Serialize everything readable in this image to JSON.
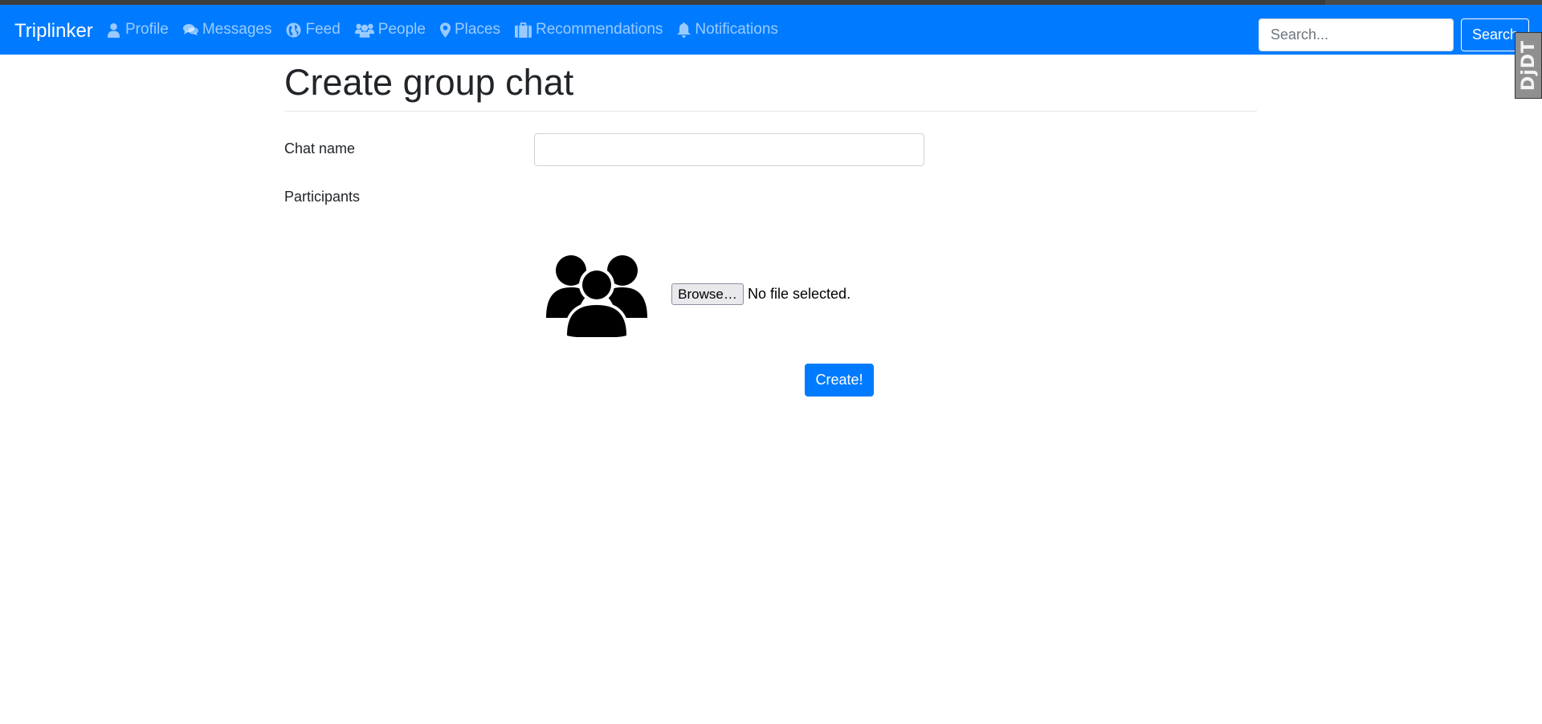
{
  "navbar": {
    "brand": "Triplinker",
    "items": [
      {
        "label": "Profile",
        "icon": "user-icon"
      },
      {
        "label": "Messages",
        "icon": "comments-icon"
      },
      {
        "label": "Feed",
        "icon": "globe-icon"
      },
      {
        "label": "People",
        "icon": "users-icon"
      },
      {
        "label": "Places",
        "icon": "map-marker-icon"
      },
      {
        "label": "Recommendations",
        "icon": "suitcase-icon"
      },
      {
        "label": "Notifications",
        "icon": "bell-icon"
      }
    ],
    "search_placeholder": "Search...",
    "search_button": "Search"
  },
  "extension_badge": "DjDT",
  "page": {
    "title": "Create group chat",
    "chat_name_label": "Chat name",
    "chat_name_value": "",
    "participants_label": "Participants",
    "avatar_icon": "group-users-icon",
    "browse_label": "Browse…",
    "file_status": "No file selected.",
    "create_label": "Create!"
  },
  "colors": {
    "primary": "#007bff",
    "nav_text": "rgba(255,255,255,0.6)"
  }
}
